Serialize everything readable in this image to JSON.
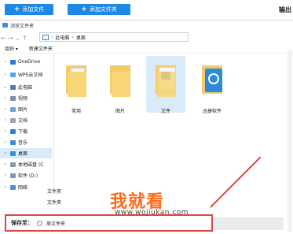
{
  "topbar": {
    "add_file": "添加文件",
    "add_folder": "添加文件夹",
    "right_text": "输出"
  },
  "dialog": {
    "title": "浏览文件夹",
    "breadcrumb": [
      "此电脑",
      "桌面"
    ],
    "toolbar": [
      "组织 ▾",
      "新建文件夹"
    ]
  },
  "sidebar": {
    "items": [
      {
        "label": "OneDrive",
        "icon": "cloud-icon"
      },
      {
        "label": "WPS云文档",
        "icon": "cloud-icon"
      },
      {
        "label": "此电脑",
        "icon": "computer-icon"
      },
      {
        "label": "视频",
        "icon": "video-icon"
      },
      {
        "label": "图片",
        "icon": "picture-icon"
      },
      {
        "label": "文档",
        "icon": "document-icon"
      },
      {
        "label": "下载",
        "icon": "download-icon"
      },
      {
        "label": "音乐",
        "icon": "music-icon"
      },
      {
        "label": "桌面",
        "icon": "desktop-icon"
      },
      {
        "label": "本地磁盘 (C",
        "icon": "drive-icon"
      },
      {
        "label": "软件 (D:)",
        "icon": "drive-icon"
      },
      {
        "label": "网络",
        "icon": "network-icon"
      }
    ]
  },
  "files": [
    {
      "label": "常用"
    },
    {
      "label": "图片"
    },
    {
      "label": "文件"
    },
    {
      "label": "迅捷软件"
    }
  ],
  "bottom": {
    "folder_label": "文件夹",
    "type_label": "文件夹",
    "save_to": "保存至：",
    "option": "原文件夹"
  },
  "watermark": {
    "cn": "我就看",
    "url": "www.wojiukan.com"
  },
  "colors": {
    "accent": "#1e88e5",
    "highlight": "#e0463f",
    "selection": "#d9ebf9"
  }
}
